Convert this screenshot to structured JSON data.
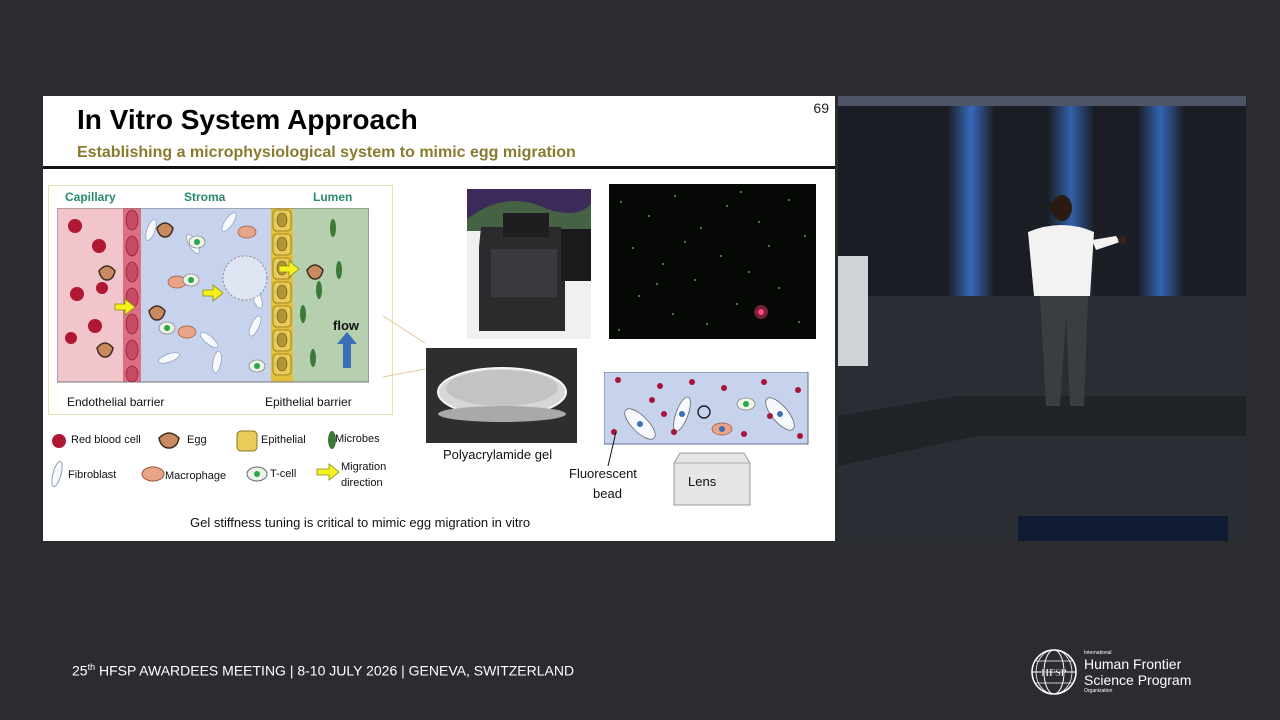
{
  "slide": {
    "number": "69",
    "title": "In Vitro System Approach",
    "subtitle": "Establishing a microphysiological system to mimic egg migration",
    "regions": [
      "Capillary",
      "Stroma",
      "Lumen"
    ],
    "flow_label": "flow",
    "endothelial_label": "Endothelial barrier",
    "epithelial_label": "Epithelial barrier",
    "legend": {
      "red_blood_cell": "Red blood cell",
      "egg": "Egg",
      "epithelial": "Epithelial",
      "microbes": "Microbes",
      "fibroblast": "Fibroblast",
      "macrophage": "Macrophage",
      "tcell": "T-cell",
      "migration_line1": "Migration",
      "migration_line2": "direction"
    },
    "gel_label": "Polyacrylamide gel",
    "bead_line1": "Fluorescent",
    "bead_line2": "bead",
    "lens_label": "Lens",
    "footnote": "Gel stiffness tuning is critical to mimic egg migration in vitro"
  },
  "footer": {
    "prefix": "25",
    "sup": "th",
    "text": " HFSP AWARDEES MEETING | 8-10 JULY 2026 | GENEVA, SWITZERLAND"
  },
  "logo": {
    "mark": "HFSP",
    "small_top": "International",
    "line1": "Human Frontier",
    "line2": "Science Program",
    "small_bottom": "Organization"
  },
  "colors": {
    "background": "#2a2c2f",
    "subtitle": "#8a7a2e",
    "region_label": "#2a8a6e",
    "capillary": "#f2c4cc",
    "stroma": "#c7d3ec",
    "lumen": "#b6cfae",
    "epithelial": "#e3bf3b"
  }
}
